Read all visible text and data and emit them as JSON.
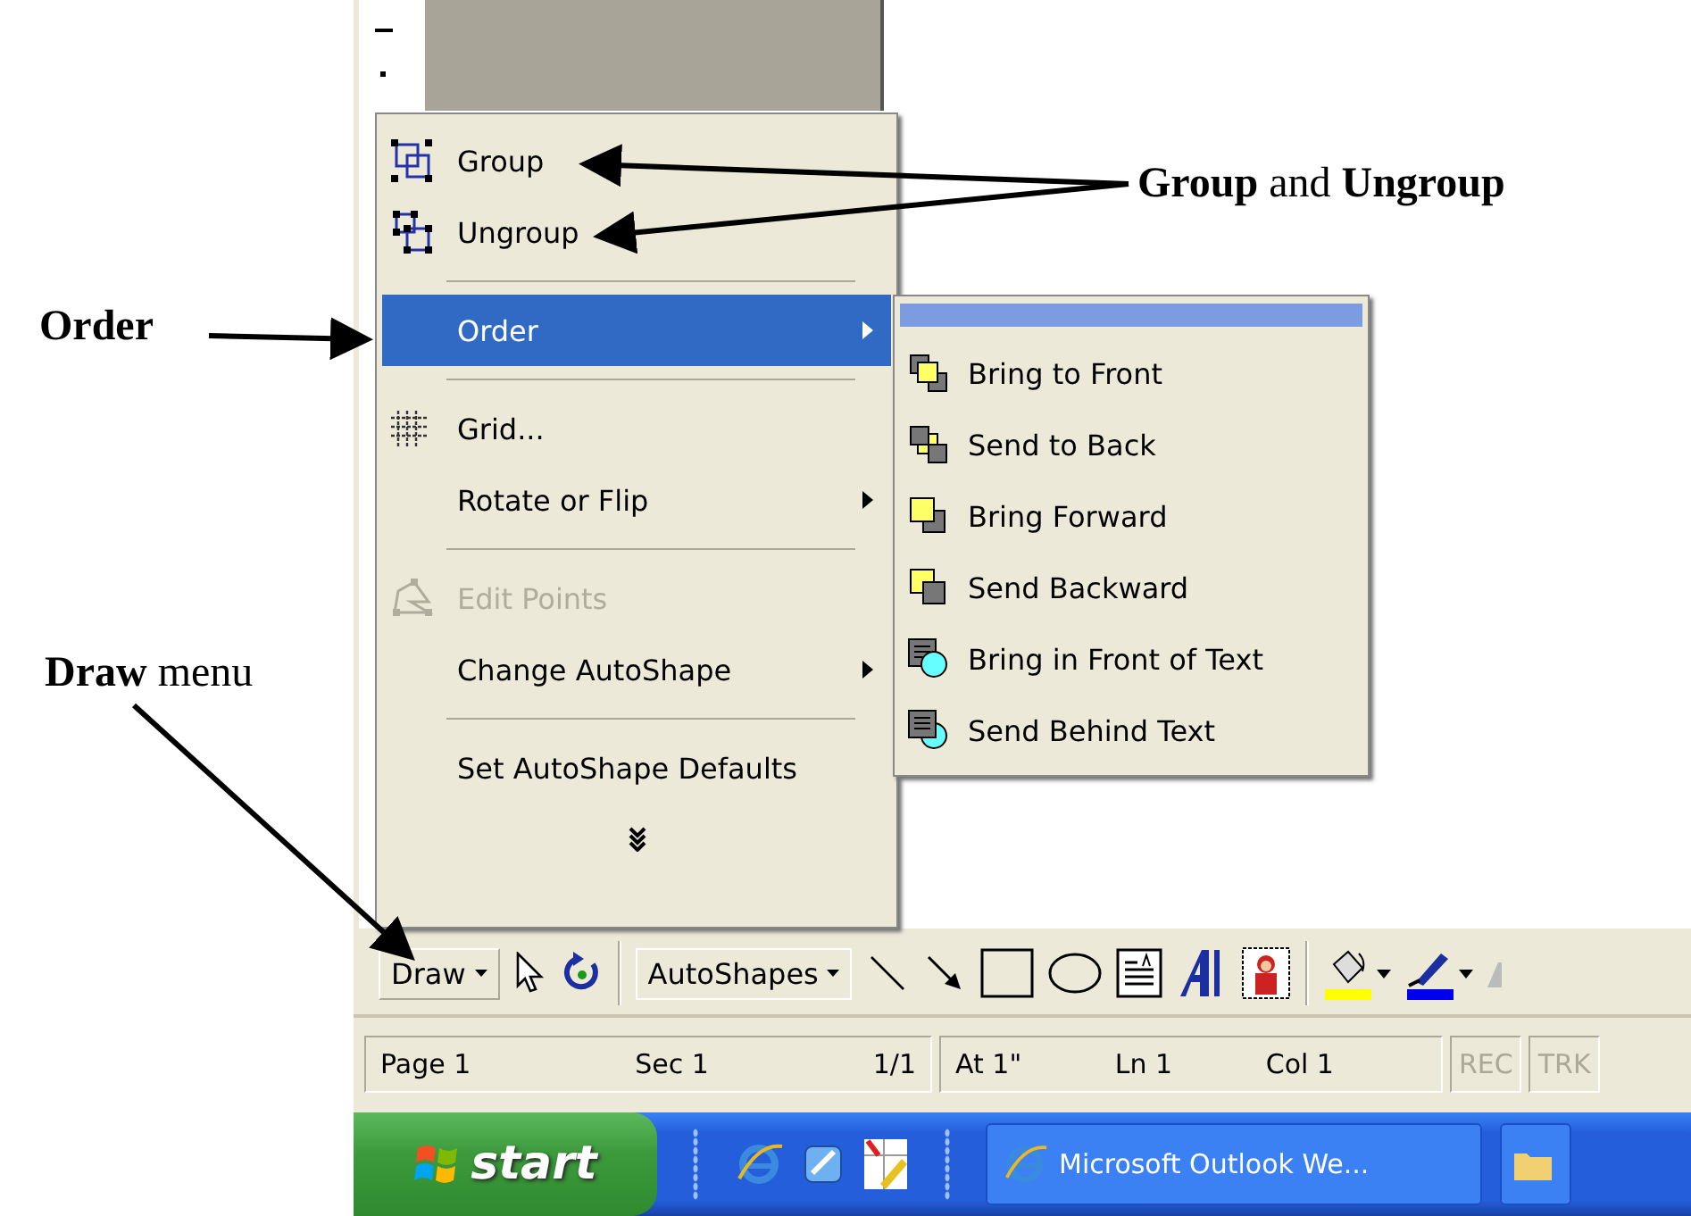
{
  "annotations": {
    "group_label": "**Group** and **Ungroup**",
    "order_label": "Order",
    "draw_label": "**Draw** menu"
  },
  "draw_menu": {
    "items": [
      {
        "kind": "command",
        "label": "Group",
        "disabled": false,
        "selected": false
      },
      {
        "kind": "command",
        "label": "Ungroup",
        "disabled": false,
        "selected": false
      },
      {
        "kind": "separator"
      },
      {
        "kind": "submenu",
        "label": "Order",
        "disabled": false,
        "selected": true
      },
      {
        "kind": "separator"
      },
      {
        "kind": "command",
        "label": "Grid...",
        "disabled": false,
        "selected": false
      },
      {
        "kind": "submenu",
        "label": "Rotate or Flip",
        "disabled": false,
        "selected": false
      },
      {
        "kind": "separator"
      },
      {
        "kind": "command",
        "label": "Edit Points",
        "disabled": true,
        "selected": false
      },
      {
        "kind": "submenu",
        "label": "Change AutoShape",
        "disabled": false,
        "selected": false
      },
      {
        "kind": "separator"
      },
      {
        "kind": "command",
        "label": "Set AutoShape Defaults",
        "disabled": false,
        "selected": false
      },
      {
        "kind": "expand"
      }
    ]
  },
  "order_submenu": {
    "items": [
      {
        "label": "Bring to Front"
      },
      {
        "label": "Send to Back"
      },
      {
        "label": "Bring Forward"
      },
      {
        "label": "Send Backward"
      },
      {
        "label": "Bring in Front of Text"
      },
      {
        "label": "Send Behind Text"
      }
    ]
  },
  "toolbar": {
    "draw_button": "Draw",
    "autoshapes_button": "AutoShapes"
  },
  "status_bar": {
    "sections": [
      {
        "fields": [
          "Page 1",
          "Sec 1",
          "1/1"
        ],
        "disabled": false
      },
      {
        "fields": [
          "At 1\"",
          "Ln 1",
          "Col 1"
        ],
        "disabled": false
      },
      {
        "fields": [
          "REC"
        ],
        "disabled": true
      },
      {
        "fields": [
          "TRK"
        ],
        "disabled": true
      }
    ]
  },
  "taskbar": {
    "start": "start",
    "tasks": [
      {
        "label": "Microsoft Outlook We..."
      }
    ]
  }
}
